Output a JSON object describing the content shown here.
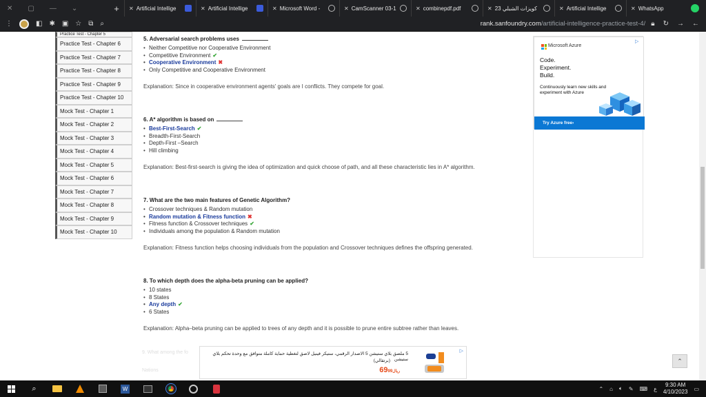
{
  "browser": {
    "tabs": [
      {
        "title": "Artificial Intellige",
        "icon": "sanfoundry-icon"
      },
      {
        "title": "Artificial Intellige",
        "icon": "sanfoundry-icon"
      },
      {
        "title": "Microsoft Word -",
        "icon": "globe-icon"
      },
      {
        "title": "CamScanner 03-1",
        "icon": "globe-icon"
      },
      {
        "title": "combinepdf.pdf",
        "icon": "globe-icon"
      },
      {
        "title": "كويزات الشبلي 23",
        "icon": "globe-icon"
      },
      {
        "title": "Artificial Intellige",
        "icon": "globe-icon"
      },
      {
        "title": "WhatsApp",
        "icon": "whatsapp-icon"
      }
    ],
    "url_host": "rank.sanfoundry.com",
    "url_path": "/artificial-intelligence-practice-test-4/"
  },
  "sidebar": {
    "items": [
      "Practice Test - Chapter 5",
      "Practice Test - Chapter 6",
      "Practice Test - Chapter 7",
      "Practice Test - Chapter 8",
      "Practice Test - Chapter 9",
      "Practice Test - Chapter 10",
      "Mock Test - Chapter 1",
      "Mock Test - Chapter 2",
      "Mock Test - Chapter 3",
      "Mock Test - Chapter 4",
      "Mock Test - Chapter 5",
      "Mock Test - Chapter 6",
      "Mock Test - Chapter 7",
      "Mock Test - Chapter 8",
      "Mock Test - Chapter 9",
      "Mock Test - Chapter 10"
    ]
  },
  "questions": [
    {
      "title": "5. Adversarial search problems uses",
      "options": [
        "Neither Competitive nor Cooperative Environment",
        "Competitive Environment",
        "Cooperative Environment",
        "Only Competitive and Cooperative Environment"
      ],
      "explanation": "Explanation: Since in cooperative environment agents' goals are I conflicts. They compete for goal."
    },
    {
      "title": "6. A* algorithm is based on",
      "options": [
        "Best-First-Search",
        "Breadth-First-Search",
        "Depth-First –Search",
        "Hill climbing"
      ],
      "explanation": "Explanation: Best-first-search is giving the idea of optimization and quick choose of path, and all these characteristic lies in A* algorithm."
    },
    {
      "title": "7. What are the two main features of Genetic Algorithm?",
      "options": [
        "Crossover techniques & Random mutation",
        "Random mutation & Fitness function",
        "Fitness function & Crossover techniques",
        "Individuals among the population & Random mutation"
      ],
      "explanation": "Explanation: Fitness function helps choosing individuals from the population and Crossover techniques defines the offspring generated."
    },
    {
      "title": "8. To which depth does the alpha-beta pruning can be applied?",
      "options": [
        "10 states",
        "8 States",
        "Any depth",
        "6 States"
      ],
      "explanation": "Explanation: Alpha–beta pruning can be applied to trees of any depth and it is possible to prune entire subtree rather than leaves."
    }
  ],
  "ad_right": {
    "brand": "Microsoft Azure",
    "headline": [
      "Code.",
      "Experiment.",
      "Build."
    ],
    "sub": "Continuously learn new skills and experiment with Azure",
    "cta": "Try Azure free›"
  },
  "bottom_ad": {
    "line1": "5 ملصق بلاي ستيشن 5 الاصدار الرقمي، ستيكر فينيل لاصق لتغطية حماية كاملة متوافق مع وحدة تحكم بلاي ستيشن",
    "line2": "(برتقالي)",
    "price": "69",
    "price_cents": "99",
    "currency": "ريال",
    "faded_text": "9. What among the fo",
    "faded_text2": "Nations"
  },
  "taskbar": {
    "time": "9:30 AM",
    "date": "4/10/2023",
    "lang": "ع"
  },
  "colors": {
    "selected": "#1a3b9c",
    "correct": "#3aa83a",
    "wrong": "#e03232",
    "azure": "#0b78d4"
  }
}
